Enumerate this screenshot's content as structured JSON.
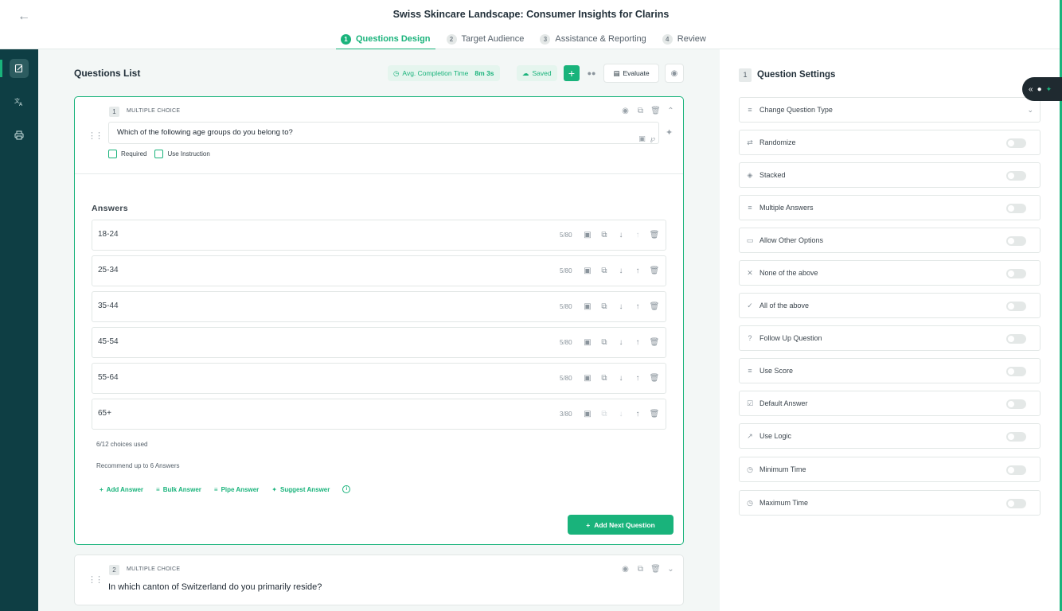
{
  "header": {
    "title": "Swiss Skincare Landscape: Consumer Insights for Clarins",
    "steps": [
      {
        "num": "1",
        "label": "Questions Design"
      },
      {
        "num": "2",
        "label": "Target Audience"
      },
      {
        "num": "3",
        "label": "Assistance & Reporting"
      },
      {
        "num": "4",
        "label": "Review"
      }
    ],
    "active_step": "Questions Design"
  },
  "toolbar": {
    "title": "Questions List",
    "completion_label": "Avg. Completion Time",
    "completion_value": "8m 3s",
    "saved_label": "Saved",
    "evaluate_label": "Evaluate"
  },
  "question1": {
    "number": "1",
    "type": "MULTIPLE CHOICE",
    "text": "Which of the following age groups do you belong to?",
    "required_label": "Required",
    "use_instruction_label": "Use Instruction",
    "answers_label": "Answers",
    "answers": [
      {
        "text": "18-24",
        "count": "5/80"
      },
      {
        "text": "25-34",
        "count": "5/80"
      },
      {
        "text": "35-44",
        "count": "5/80"
      },
      {
        "text": "45-54",
        "count": "5/80"
      },
      {
        "text": "55-64",
        "count": "5/80"
      },
      {
        "text": "65+",
        "count": "3/80"
      }
    ],
    "choices_used": "6/12 choices used",
    "recommend": "Recommend up to 6 Answers",
    "actions": {
      "add": "Add Answer",
      "bulk": "Bulk Answer",
      "pipe": "Pipe Answer",
      "suggest": "Suggest Answer"
    },
    "add_next_label": "Add Next Question"
  },
  "question2": {
    "number": "2",
    "type": "MULTIPLE CHOICE",
    "text": "In which canton of Switzerland do you primarily reside?"
  },
  "settings": {
    "number": "1",
    "title": "Question Settings",
    "change_type_label": "Change Question Type",
    "options": [
      {
        "label": "Randomize",
        "icon": "shuffle-icon"
      },
      {
        "label": "Stacked",
        "icon": "layers-icon"
      },
      {
        "label": "Multiple Answers",
        "icon": "list-check-icon"
      },
      {
        "label": "Allow Other Options",
        "icon": "folder-icon"
      },
      {
        "label": "None of the above",
        "icon": "x-icon"
      },
      {
        "label": "All of the above",
        "icon": "double-check-icon"
      },
      {
        "label": "Follow Up Question",
        "icon": "question-circle-icon"
      },
      {
        "label": "Use Score",
        "icon": "ordered-list-icon"
      },
      {
        "label": "Default Answer",
        "icon": "checkbox-icon"
      },
      {
        "label": "Use Logic",
        "icon": "trend-icon"
      },
      {
        "label": "Minimum Time",
        "icon": "clock-icon"
      },
      {
        "label": "Maximum Time",
        "icon": "clock-icon"
      }
    ]
  },
  "colors": {
    "accent": "#19b37b",
    "rail": "#0e3e44",
    "background": "#f3f7f6"
  }
}
